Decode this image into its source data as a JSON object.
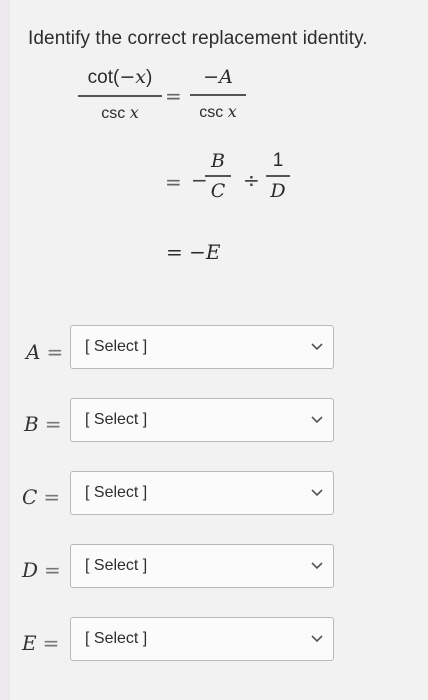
{
  "prompt": "Identify the correct replacement identity.",
  "equation": {
    "lhs_num": "cot(−x)",
    "lhs_den": "csc x",
    "rhs1_num": "−A",
    "rhs1_den": "csc x",
    "step2": {
      "sign": "−",
      "b": "B",
      "c": "C",
      "divide": "÷",
      "one": "1",
      "d": "D"
    },
    "step3": "= −E",
    "equals": "="
  },
  "rows": [
    {
      "var": "A",
      "equals": "=",
      "value": "[ Select ]"
    },
    {
      "var": "B",
      "equals": "=",
      "value": "[ Select ]"
    },
    {
      "var": "C",
      "equals": "=",
      "value": "[ Select ]"
    },
    {
      "var": "D",
      "equals": "=",
      "value": "[ Select ]"
    },
    {
      "var": "E",
      "equals": "=",
      "value": "[ Select ]"
    }
  ],
  "icons": {
    "dropdown": "chevron-down-icon"
  }
}
